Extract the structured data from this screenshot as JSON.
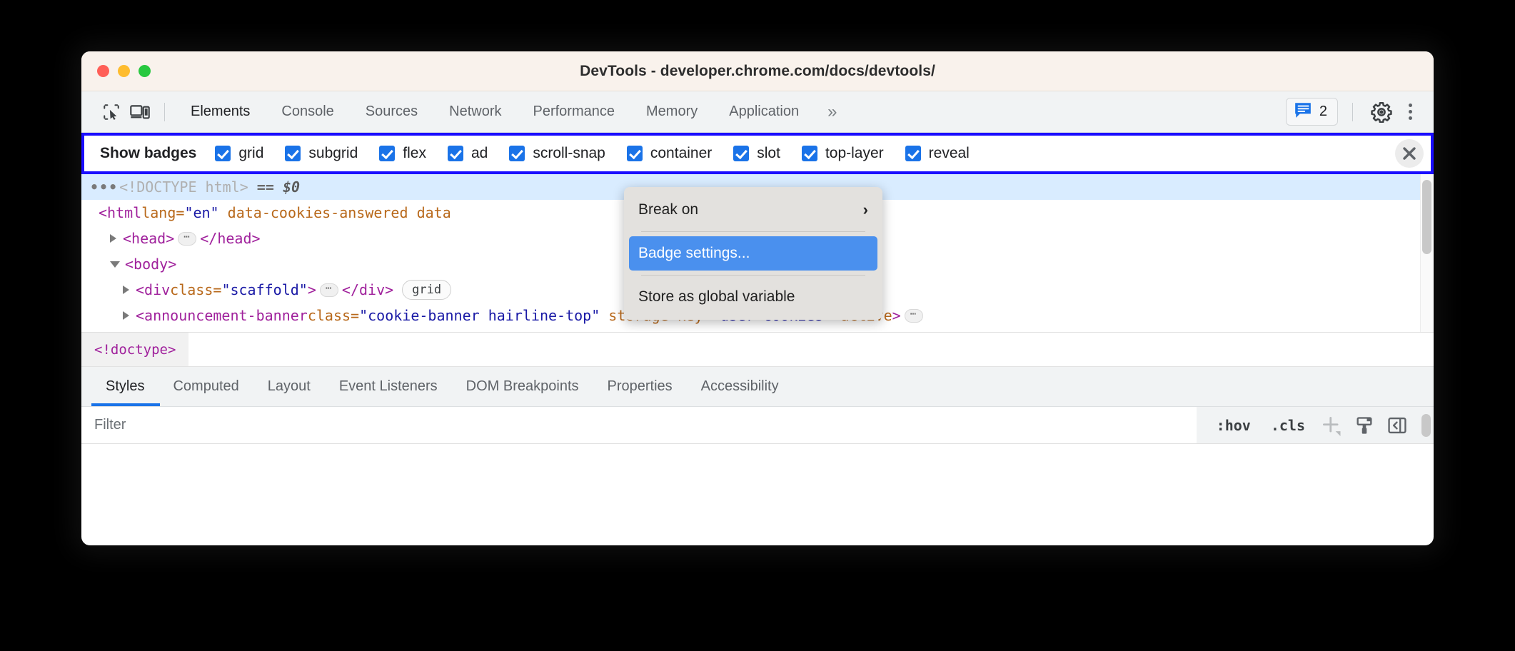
{
  "window": {
    "title": "DevTools - developer.chrome.com/docs/devtools/",
    "traffic": {
      "close": "close-window",
      "minimize": "minimize-window",
      "zoom": "zoom-window"
    }
  },
  "toolbar": {
    "inspect_icon": "inspect-element-icon",
    "device_icon": "device-toolbar-icon",
    "tabs": [
      {
        "label": "Elements",
        "active": true
      },
      {
        "label": "Console",
        "active": false
      },
      {
        "label": "Sources",
        "active": false
      },
      {
        "label": "Network",
        "active": false
      },
      {
        "label": "Performance",
        "active": false
      },
      {
        "label": "Memory",
        "active": false
      },
      {
        "label": "Application",
        "active": false
      }
    ],
    "more_tabs": "»",
    "issues_count": "2",
    "issues_icon": "issues-speech-bubble-icon",
    "settings_icon": "gear-icon",
    "menu_icon": "three-dot-menu-icon"
  },
  "badge_bar": {
    "label": "Show badges",
    "highlight_color": "#1a0dff",
    "checkbox_color": "#1a73e8",
    "items": [
      {
        "label": "grid",
        "checked": true
      },
      {
        "label": "subgrid",
        "checked": true
      },
      {
        "label": "flex",
        "checked": true
      },
      {
        "label": "ad",
        "checked": true
      },
      {
        "label": "scroll-snap",
        "checked": true
      },
      {
        "label": "container",
        "checked": true
      },
      {
        "label": "slot",
        "checked": true
      },
      {
        "label": "top-layer",
        "checked": true
      },
      {
        "label": "reveal",
        "checked": true
      }
    ],
    "close_label": "✕"
  },
  "dom_tree": {
    "rows": {
      "doctype": {
        "lead_dots": "•••",
        "text": "<!DOCTYPE html>",
        "eq": "==",
        "selector": "$0"
      },
      "html": {
        "open": "<html ",
        "attr1": "lang",
        "eq": "=",
        "val1": "\"en\"",
        "attr2": "data-cookies-answered",
        "attr3": "data"
      },
      "head": {
        "open": "<head>",
        "close": "</head>",
        "ellipsis": "…"
      },
      "body": {
        "open": "<body>"
      },
      "div": {
        "open": "<div ",
        "attr": "class",
        "eq": "=",
        "val": "\"scaffold\"",
        "gt": ">",
        "close": "</div>",
        "badge": "grid"
      },
      "banner": {
        "open": "<announcement-banner ",
        "attr1": "class",
        "eq1": "=",
        "val1": "\"cookie-banner hairline-top\"",
        "attr2": "storage-key",
        "eq2": "=",
        "val2": "\"user-cookies\"",
        "attr3": "active",
        "gt": ">"
      }
    },
    "colors": {
      "tag": "#a0219c",
      "attribute": "#b8681a",
      "value": "#1a1aa6",
      "doctype": "#b0b0b0",
      "selected_row": "#d9ecff"
    }
  },
  "context_menu": {
    "items": [
      {
        "label": "Break on",
        "has_submenu": true,
        "highlighted": false,
        "arrow": "›"
      },
      {
        "label": "Badge settings...",
        "has_submenu": false,
        "highlighted": true
      },
      {
        "label": "Store as global variable",
        "has_submenu": false,
        "highlighted": false
      }
    ],
    "highlight_color": "#4a90ee"
  },
  "breadcrumb": {
    "items": [
      {
        "label": "<!doctype>",
        "selected": true
      }
    ]
  },
  "sub_tabs": {
    "tabs": [
      {
        "label": "Styles",
        "active": true
      },
      {
        "label": "Computed",
        "active": false
      },
      {
        "label": "Layout",
        "active": false
      },
      {
        "label": "Event Listeners",
        "active": false
      },
      {
        "label": "DOM Breakpoints",
        "active": false
      },
      {
        "label": "Properties",
        "active": false
      },
      {
        "label": "Accessibility",
        "active": false
      }
    ],
    "underline_color": "#1a73e8"
  },
  "filter_bar": {
    "placeholder": "Filter",
    "value": "",
    "hov_label": ":hov",
    "cls_label": ".cls",
    "new_rule_icon": "plus-new-style-rule-icon",
    "print_icon": "paintbrush-icon",
    "sidebar_icon": "toggle-sidebar-icon"
  }
}
